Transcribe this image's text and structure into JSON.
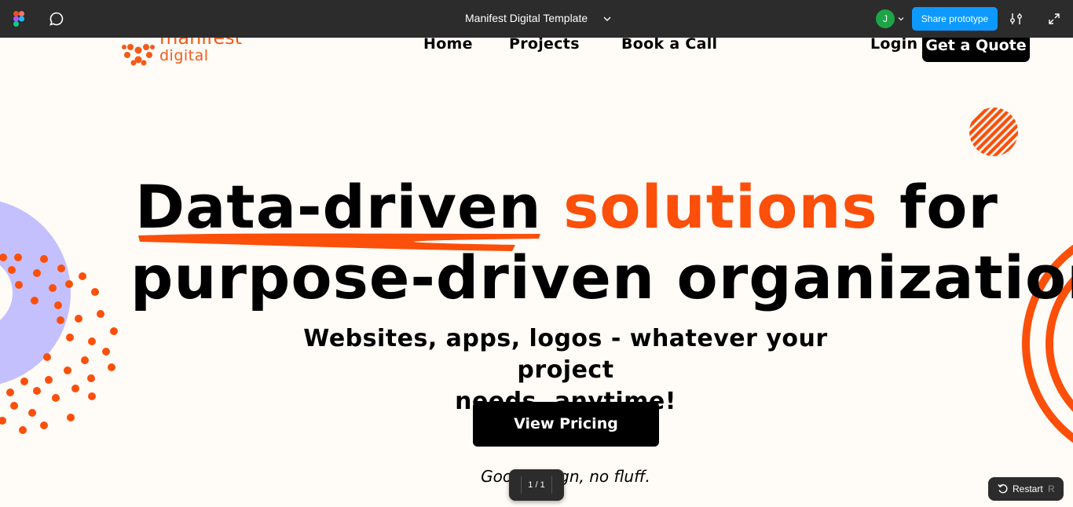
{
  "topbar": {
    "file_title": "Manifest Digital Template",
    "avatar_initial": "J",
    "share_label": "Share prototype",
    "bg_color": "#2c2c2c",
    "accent_color": "#0d99ff"
  },
  "site": {
    "brand_top": "manifest",
    "brand_bottom": "digital",
    "nav": [
      "Home",
      "Projects",
      "Book a Call"
    ],
    "login_label": "Login",
    "quote_label": "Get a Quote",
    "headline_part1": "Data-driven",
    "headline_highlight": "solutions",
    "headline_part2": "for",
    "headline_line2": "purpose-driven organizations.",
    "subheadline_line1": "Websites, apps, logos - whatever your project",
    "subheadline_line2": "needs, anytime!",
    "cta_label": "View Pricing",
    "tagline": "Good design, no fluff.",
    "accent_color": "#fc4f0a",
    "lavender_color": "#c4c0fe"
  },
  "prototype": {
    "page_indicator": "1 / 1",
    "restart_label": "Restart",
    "restart_shortcut": "R"
  }
}
